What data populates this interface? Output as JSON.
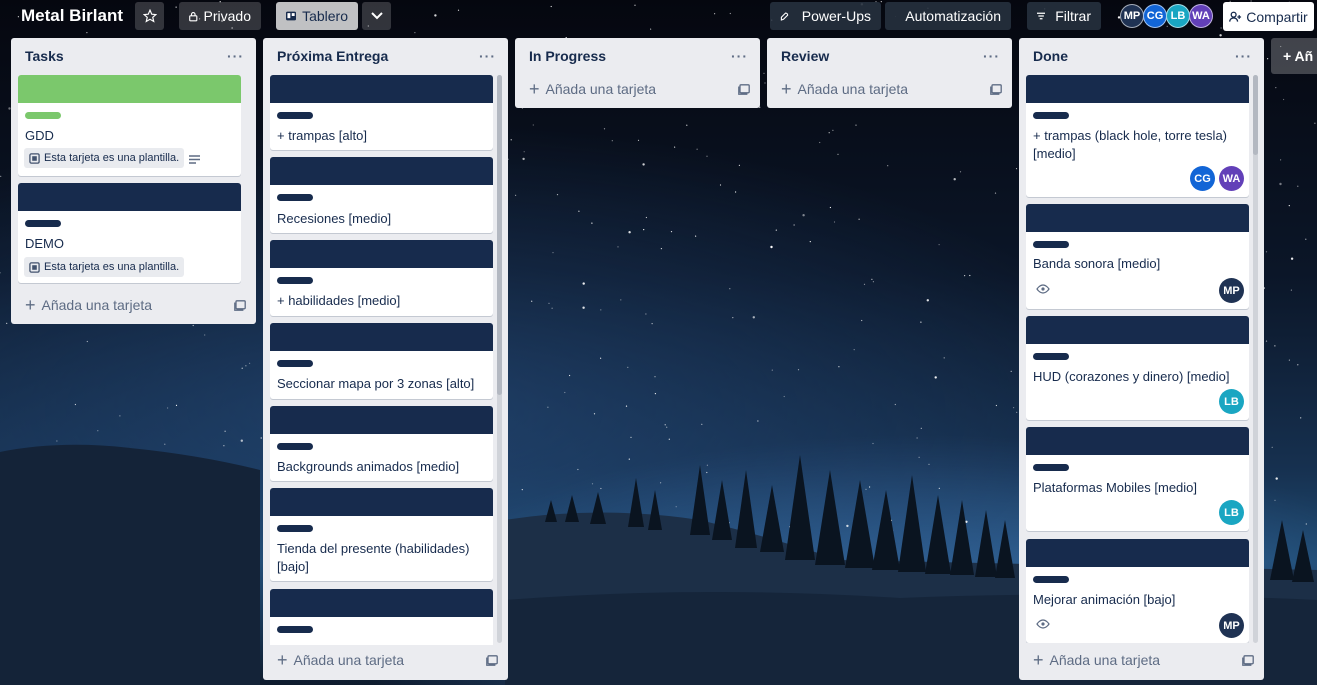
{
  "board": {
    "title": "Metal Birlant",
    "visibility": "Privado",
    "view": "Tablero",
    "powerups": "Power-Ups",
    "automation": "Automatización",
    "filter": "Filtrar",
    "share": "Compartir",
    "members": [
      {
        "initials": "MP",
        "color": "#1f3253"
      },
      {
        "initials": "CG",
        "color": "#1265d6"
      },
      {
        "initials": "LB",
        "color": "#1aa6c2"
      },
      {
        "initials": "WA",
        "color": "#6240b8"
      }
    ],
    "add_list": "+ Añ"
  },
  "add_card_label": "Añada una tarjeta",
  "template_note": "Esta tarjeta es una plantilla.",
  "lists": [
    {
      "name": "Tasks",
      "cards": [
        {
          "title": "GDD",
          "label": "green"
        },
        {
          "title": "DEMO"
        }
      ]
    },
    {
      "name": "Próxima Entrega",
      "cards": [
        {
          "title": "+ trampas [alto]"
        },
        {
          "title": "Recesiones [medio]"
        },
        {
          "title": "+ habilidades [medio]"
        },
        {
          "title": "Seccionar mapa por 3 zonas [alto]"
        },
        {
          "title": "Backgrounds animados [medio]"
        },
        {
          "title": "Tienda del presente (habilidades) [bajo]"
        },
        {
          "title": ""
        }
      ]
    },
    {
      "name": "In Progress",
      "cards": []
    },
    {
      "name": "Review",
      "cards": []
    },
    {
      "name": "Done",
      "cards": [
        {
          "title": "+ trampas (black hole, torre tesla) [medio]",
          "members": [
            "CG",
            "WA"
          ]
        },
        {
          "title": "Banda sonora [medio]",
          "members": [
            "MP"
          ]
        },
        {
          "title": "HUD (corazones y dinero) [medio]",
          "members": [
            "LB"
          ]
        },
        {
          "title": "Plataformas Mobiles [medio]",
          "members": [
            "LB"
          ]
        },
        {
          "title": "Mejorar animación [bajo]",
          "members": [
            "MP"
          ]
        }
      ]
    }
  ],
  "colors": {
    "cover": "#172b4d",
    "green_label": "#7bc86c",
    "list_bg": "#ebecf0"
  }
}
